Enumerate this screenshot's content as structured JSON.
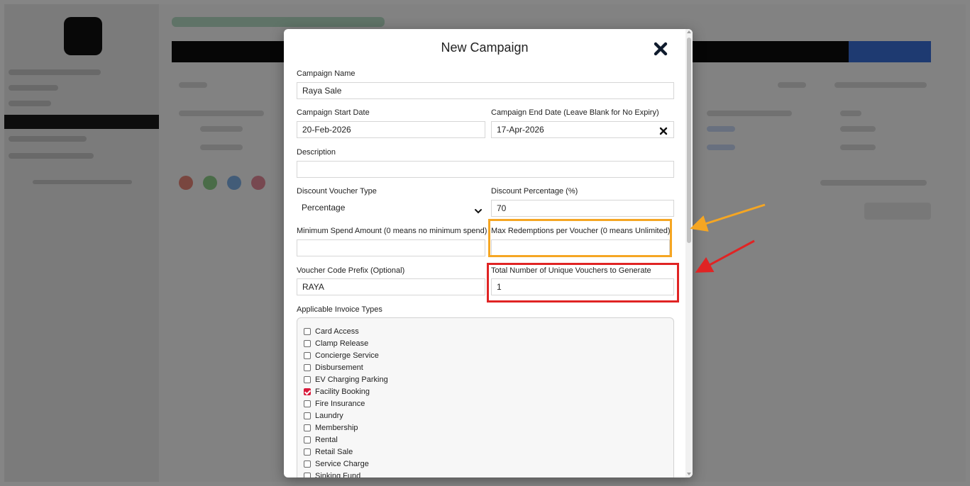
{
  "modal": {
    "title": "New Campaign"
  },
  "form": {
    "campaign_name": {
      "label": "Campaign Name",
      "value": "Raya Sale"
    },
    "start_date": {
      "label": "Campaign Start Date",
      "value": "20-Feb-2026"
    },
    "end_date": {
      "label": "Campaign End Date (Leave Blank for No Expiry)",
      "value": "17-Apr-2026"
    },
    "description": {
      "label": "Description",
      "value": ""
    },
    "voucher_type": {
      "label": "Discount Voucher Type",
      "value": "Percentage"
    },
    "discount_percentage": {
      "label": "Discount Percentage (%)",
      "value": "70"
    },
    "min_spend": {
      "label": "Minimum Spend Amount (0 means no minimum spend)",
      "value": ""
    },
    "max_redemptions": {
      "label": "Max Redemptions per Voucher (0 means Unlimited)",
      "value": ""
    },
    "code_prefix": {
      "label": "Voucher Code Prefix (Optional)",
      "value": "RAYA"
    },
    "total_vouchers": {
      "label": "Total Number of Unique Vouchers to Generate",
      "value": "1"
    },
    "invoice_types": {
      "label": "Applicable Invoice Types",
      "options": [
        {
          "label": "Card Access",
          "checked": false
        },
        {
          "label": "Clamp Release",
          "checked": false
        },
        {
          "label": "Concierge Service",
          "checked": false
        },
        {
          "label": "Disbursement",
          "checked": false
        },
        {
          "label": "EV Charging Parking",
          "checked": false
        },
        {
          "label": "Facility Booking",
          "checked": true
        },
        {
          "label": "Fire Insurance",
          "checked": false
        },
        {
          "label": "Laundry",
          "checked": false
        },
        {
          "label": "Membership",
          "checked": false
        },
        {
          "label": "Rental",
          "checked": false
        },
        {
          "label": "Retail Sale",
          "checked": false
        },
        {
          "label": "Service Charge",
          "checked": false
        },
        {
          "label": "Sinking Fund",
          "checked": false
        }
      ]
    }
  },
  "colors": {
    "highlight_orange": "#f5a623",
    "highlight_red": "#e02424",
    "checkbox_checked": "#d81b3c"
  }
}
